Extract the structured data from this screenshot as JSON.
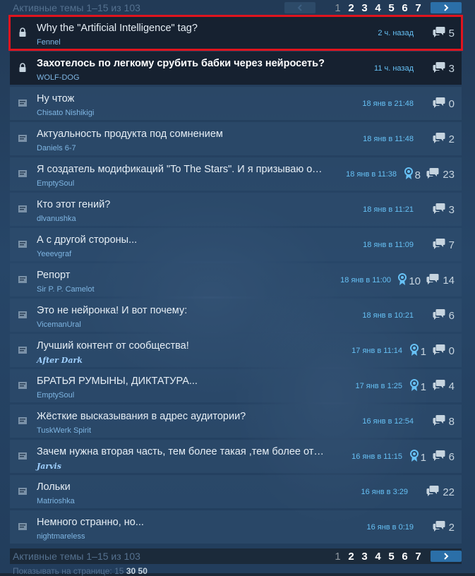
{
  "pagination": {
    "summary": "Активные темы 1–15 из 103",
    "prev_icon": "chevron-left-icon",
    "next_icon": "chevron-right-icon",
    "pages": [
      "1",
      "2",
      "3",
      "4",
      "5",
      "6",
      "7"
    ],
    "current_page": "1"
  },
  "topics": [
    {
      "title": "Why the \"Artificial Intelligence\" tag?",
      "author": "Fennel",
      "time": "2 ч. назад",
      "replies": "5",
      "sticky": true,
      "locked": true,
      "highlighted": true
    },
    {
      "title": "Захотелось по легкому срубить бабки через нейросеть?",
      "author": "WOLF-DOG",
      "time": "11 ч. назад",
      "replies": "3",
      "sticky": true,
      "locked": true,
      "bold": true
    },
    {
      "title": "Ну чтож",
      "author": "Chisato Nishikigi",
      "time": "18 янв в 21:48",
      "replies": "0"
    },
    {
      "title": "Актуальность продукта под сомнением",
      "author": "Daniels 6-7",
      "time": "18 янв в 11:48",
      "replies": "2"
    },
    {
      "title": "Я создатель модификаций \"To The Stars\". И я призываю отк...",
      "author": "EmptySoul",
      "time": "18 янв в 11:38",
      "awards": "8",
      "replies": "23"
    },
    {
      "title": "Кто этот гений?",
      "author": "dlvanushka",
      "time": "18 янв в 11:21",
      "replies": "3"
    },
    {
      "title": "А с другой стороны...",
      "author": "Yeeevgraf",
      "time": "18 янв в 11:09",
      "replies": "7"
    },
    {
      "title": "Репорт",
      "author": "Sir P. P. Camelot",
      "time": "18 янв в 11:00",
      "awards": "10",
      "replies": "14"
    },
    {
      "title": "Это не нейронка! И вот почему:",
      "author": "VicemanUral",
      "time": "18 янв в 10:21",
      "replies": "6"
    },
    {
      "title": "Лучший контент от сообщества!",
      "author": "After Dark",
      "author_fancy": true,
      "time": "17 янв в 11:14",
      "awards": "1",
      "replies": "0"
    },
    {
      "title": "БРАТЬЯ РУМЫНЫ, ДИКТАТУРА...",
      "author": "EmptySoul",
      "time": "17 янв в 1:25",
      "awards": "1",
      "replies": "4"
    },
    {
      "title": "Жёсткие высказывания в адрес аудитории?",
      "author": "TuskWerk Spirit",
      "time": "16 янв в 12:54",
      "replies": "8"
    },
    {
      "title": "Зачем нужна вторая часть, тем более такая ,тем более от лю...",
      "author": "Jarvis",
      "author_fancy": true,
      "time": "16 янв в 11:15",
      "awards": "1",
      "replies": "6"
    },
    {
      "title": "Лольки",
      "author": "Matrioshka",
      "time": "16 янв в 3:29",
      "replies": "22"
    },
    {
      "title": "Немного странно, но...",
      "author": "nightmareless",
      "time": "16 янв в 0:19",
      "replies": "2"
    }
  ],
  "footer": {
    "per_page_label": "Показывать на странице:",
    "options": [
      "15",
      "30",
      "50"
    ]
  },
  "colors": {
    "background": "#1b2838",
    "link": "#66c0f4",
    "highlight": "#e0141e"
  }
}
